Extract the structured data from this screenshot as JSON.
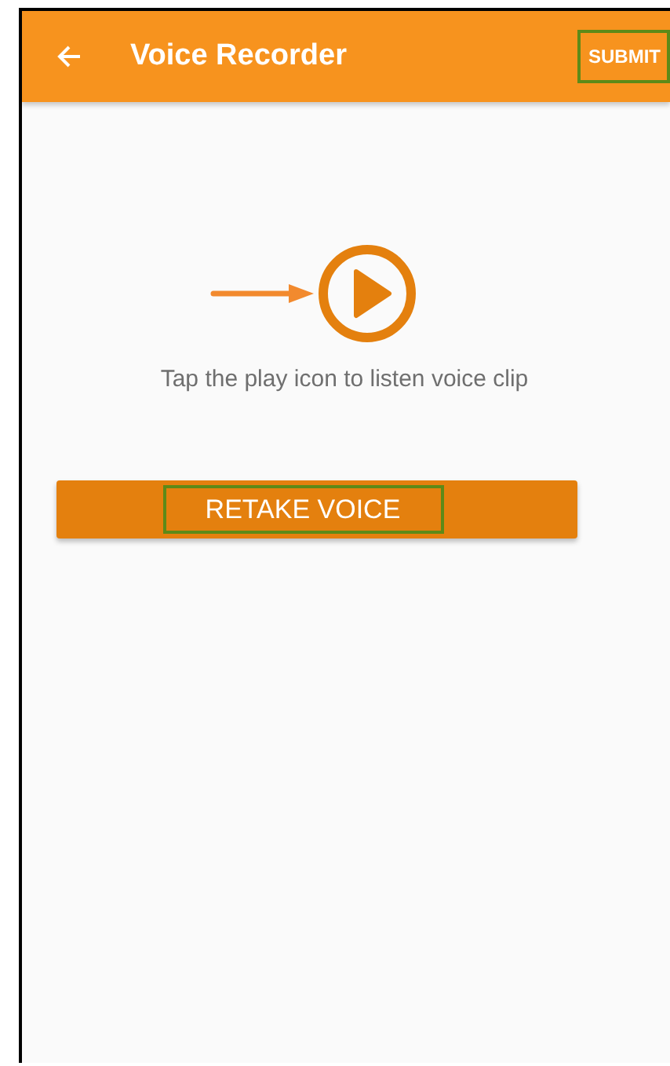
{
  "app_bar": {
    "title": "Voice Recorder",
    "action": {
      "label": "SUBMIT",
      "highlighted": true
    }
  },
  "player": {
    "hint": "Tap the play icon to listen voice clip"
  },
  "retake_button": {
    "label": "RETAKE VOICE",
    "highlighted": true
  }
}
